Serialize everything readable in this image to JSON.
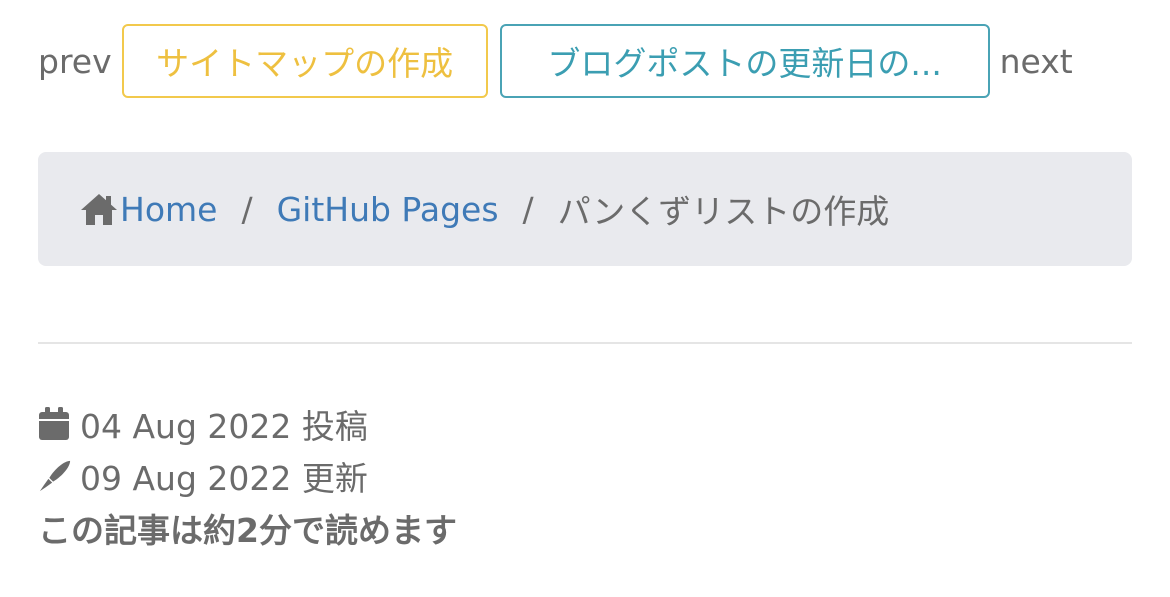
{
  "pager": {
    "prev_label": "prev",
    "prev_title": "サイトマップの作成",
    "next_title": "ブログポストの更新日の...",
    "next_label": "next"
  },
  "breadcrumb": {
    "home_icon": "home-icon",
    "home_label": "Home",
    "separator": "/",
    "category_label": "GitHub Pages",
    "current_label": "パンくずリストの作成"
  },
  "meta": {
    "posted_icon": "calendar-icon",
    "posted_date": "04 Aug 2022 投稿",
    "updated_icon": "pen-icon",
    "updated_date": "09 Aug 2022 更新",
    "reading_time": "この記事は約2分で読めます"
  },
  "colors": {
    "prev_accent": "#f2c94c",
    "next_accent": "#4aa3b5",
    "link": "#3f7ab7",
    "breadcrumb_bg": "#e9eaee"
  }
}
